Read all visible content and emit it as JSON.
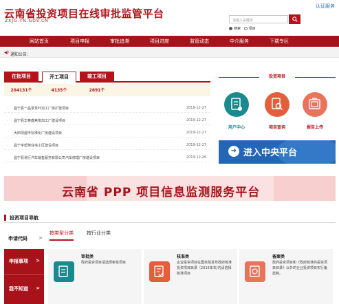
{
  "header": {
    "title": "云南省投资项目在线审批监管平台",
    "url_text": "ZXJG.YN.GOV.CN",
    "login_link": "认证服务",
    "search_placeholder": "请输入关键字",
    "search_options": [
      "搜索",
      "项目"
    ],
    "search_selected": "搜索"
  },
  "nav": {
    "items": [
      "网站首页",
      "项目申报",
      "审批追溯",
      "项目进度",
      "监管动态",
      "中介服务",
      "下载专区"
    ]
  },
  "notice": {
    "label": "通知公告:"
  },
  "project_tabs": {
    "tabs": [
      {
        "label": "在批项目",
        "count": "204131个"
      },
      {
        "label": "开工项目",
        "count": "4135个"
      },
      {
        "label": "竣工项目",
        "count": "2691个"
      }
    ],
    "active_index": 1
  },
  "projects": [
    {
      "name": "昌宁县一品茶茶叶加工厂房扩建项目",
      "date": "2019-12-27"
    },
    {
      "name": "昌宁县华奥鑫焦炭加工厂建设项目",
      "date": "2019-12-27"
    },
    {
      "name": "大田坝烟丰标准化厂房建设项目",
      "date": "2019-12-27"
    },
    {
      "name": "昌宁宇帮苑住宅小区建设项目",
      "date": "2019-12-27"
    },
    {
      "name": "昌宁县易行汽车销售服务有限公司汽车修理厂房建设项目",
      "date": "2019-12-26"
    }
  ],
  "side_panel": {
    "title": "投资项目",
    "buttons": [
      {
        "label": "用户中心",
        "icon": "user-center-icon"
      },
      {
        "label": "项目查询",
        "icon": "project-query-icon"
      },
      {
        "label": "报告上传",
        "icon": "report-upload-icon"
      }
    ],
    "central_banner": "进入中央平台"
  },
  "ppp_banner": {
    "text": "云南省 PPP 项目信息监测服务平台"
  },
  "guide": {
    "title": "投资项目导航",
    "apply_label": "申请代码",
    "apply_arrow": ">",
    "tabs": [
      "按类型分类",
      "按行业分类"
    ],
    "active_tab": "按类型分类",
    "side_categories": [
      "申报事项",
      "我不知道"
    ],
    "chevron": ">",
    "cards": [
      {
        "title": "审批类",
        "desc": "政府投资项目请选择审批项目",
        "icon": "approval-doc-icon"
      },
      {
        "title": "核准类",
        "desc": "企业投资项目在国务院发布政府核准投资项目目录（2016年本)内请选择核准项目",
        "icon": "approval-form-icon"
      },
      {
        "title": "备案类",
        "desc": "政府投资项目和《政府核准的投资项目目录》以外的企业投资项目实行备案制。",
        "icon": "record-icon"
      }
    ]
  },
  "colors": {
    "brand_red": "#b5121b",
    "nav_red": "#a8131b",
    "teal": "#1a8a8e",
    "orange": "#e65d3b",
    "blue": "#2366b6"
  }
}
